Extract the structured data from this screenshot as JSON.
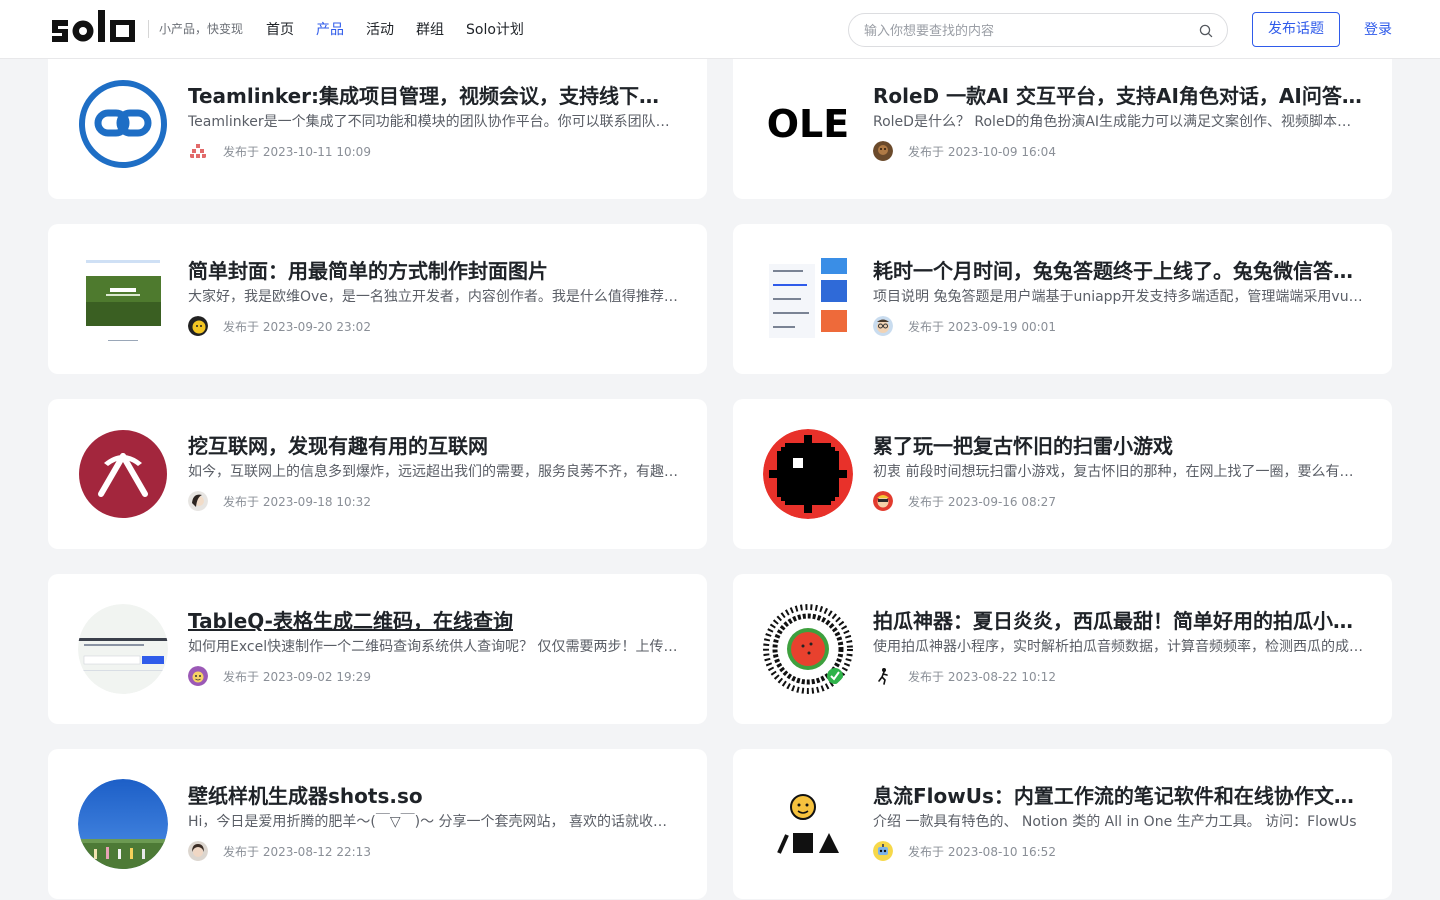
{
  "header": {
    "logo_alt": "solo",
    "slogan": "小产品，快变现",
    "nav": [
      {
        "label": "首页",
        "active": false
      },
      {
        "label": "产品",
        "active": true
      },
      {
        "label": "活动",
        "active": false
      },
      {
        "label": "群组",
        "active": false
      },
      {
        "label": "Solo计划",
        "active": false
      }
    ],
    "search_placeholder": "输入你想要查找的内容",
    "search_icon": "search-icon",
    "publish_button": "发布话题",
    "login": "登录"
  },
  "colors": {
    "accent": "#2f5bea",
    "page_bg": "#f3f4f6",
    "card_bg": "#ffffff"
  },
  "cards": [
    {
      "title": "Teamlinker:集成项目管理，视频会议，支持线下部署的团队协作工具",
      "desc": "Teamlinker是一个集成了不同功能和模块的团队协作平台。你可以联系团队成员，与成员开会，管理任务和项目",
      "time": "发布于 2023-10-11 10:09",
      "thumb_icon": "chain-link-logo",
      "avatar_icon": "pixel-avatar"
    },
    {
      "title": "RoleD 一款AI 交互平台，支持AI角色对话，AI问答，AI绘画",
      "desc": "RoleD是什么？ RoleD的角色扮演AI生成能力可以满足文案创作、视频脚本等需求",
      "time": "发布于 2023-10-09 16:04",
      "thumb_icon": "role-text-logo",
      "avatar_icon": "brown-avatar"
    },
    {
      "title": "简单封面：用最简单的方式制作封面图片",
      "desc": "大家好，我是欧维Ove，是一名独立开发者，内容创作者。我是什么值得推荐的人",
      "time": "发布于 2023-09-20 23:02",
      "thumb_icon": "cover-screenshot",
      "avatar_icon": "yellow-avatar"
    },
    {
      "title": "耗时一个月时间，兔兔答题终于上线了。兔兔微信答题小程序",
      "desc": "项目说明 兔兔答题是用户端基于uniapp开发支持多端适配，管理端端采用vue开发",
      "time": "发布于 2023-09-19 00:01",
      "thumb_icon": "quiz-screenshot",
      "avatar_icon": "glasses-avatar"
    },
    {
      "title": "挖互联网，发现有趣有用的互联网",
      "desc": "如今，互联网上的信息多到爆炸，远远超出我们的需要，服务良莠不齐，有趣有用的网站",
      "time": "发布于 2023-09-18 10:32",
      "thumb_icon": "pickaxe-logo",
      "avatar_icon": "girl-avatar"
    },
    {
      "title": "累了玩一把复古怀旧的扫雷小游戏",
      "desc": "初衷 前段时间想玩扫雷小游戏，复古怀旧的那种，在网上找了一圈，要么有广告",
      "time": "发布于 2023-09-16 08:27",
      "thumb_icon": "mine-logo",
      "avatar_icon": "red-avatar"
    },
    {
      "title": "TableQ-表格生成二维码，在线查询",
      "desc": "如何用Excel快速制作一个二维码查询系统供人查询呢？ 仅仅需要两步！上传表格",
      "time": "发布于 2023-09-02 19:29",
      "thumb_icon": "tableq-screenshot",
      "avatar_icon": "purple-avatar"
    },
    {
      "title": "拍瓜神器：夏日炎炎，西瓜最甜！简单好用的拍瓜小程序",
      "desc": "使用拍瓜神器小程序，实时解析拍瓜音频数据，计算音频频率，检测西瓜的成熟度",
      "time": "发布于 2023-08-22 10:12",
      "thumb_icon": "watermelon-qrcode",
      "avatar_icon": "runner-avatar"
    },
    {
      "title": "壁纸样机生成器shots.so",
      "desc": "Hi，今日是爱用折腾的肥羊～(￣▽￣)～ 分享一个套壳网站， 喜欢的话就收藏吧",
      "time": "发布于 2023-08-12 22:13",
      "thumb_icon": "photo-sky",
      "avatar_icon": "face-avatar"
    },
    {
      "title": "息流FlowUs：内置工作流的笔记软件和在线协作文档平台",
      "desc": "介绍 一款具有特色的、 Notion 类的 All in One 生产力工具。 访问：FlowUs",
      "time": "发布于 2023-08-10 16:52",
      "thumb_icon": "flowus-logo",
      "avatar_icon": "robot-avatar"
    }
  ]
}
